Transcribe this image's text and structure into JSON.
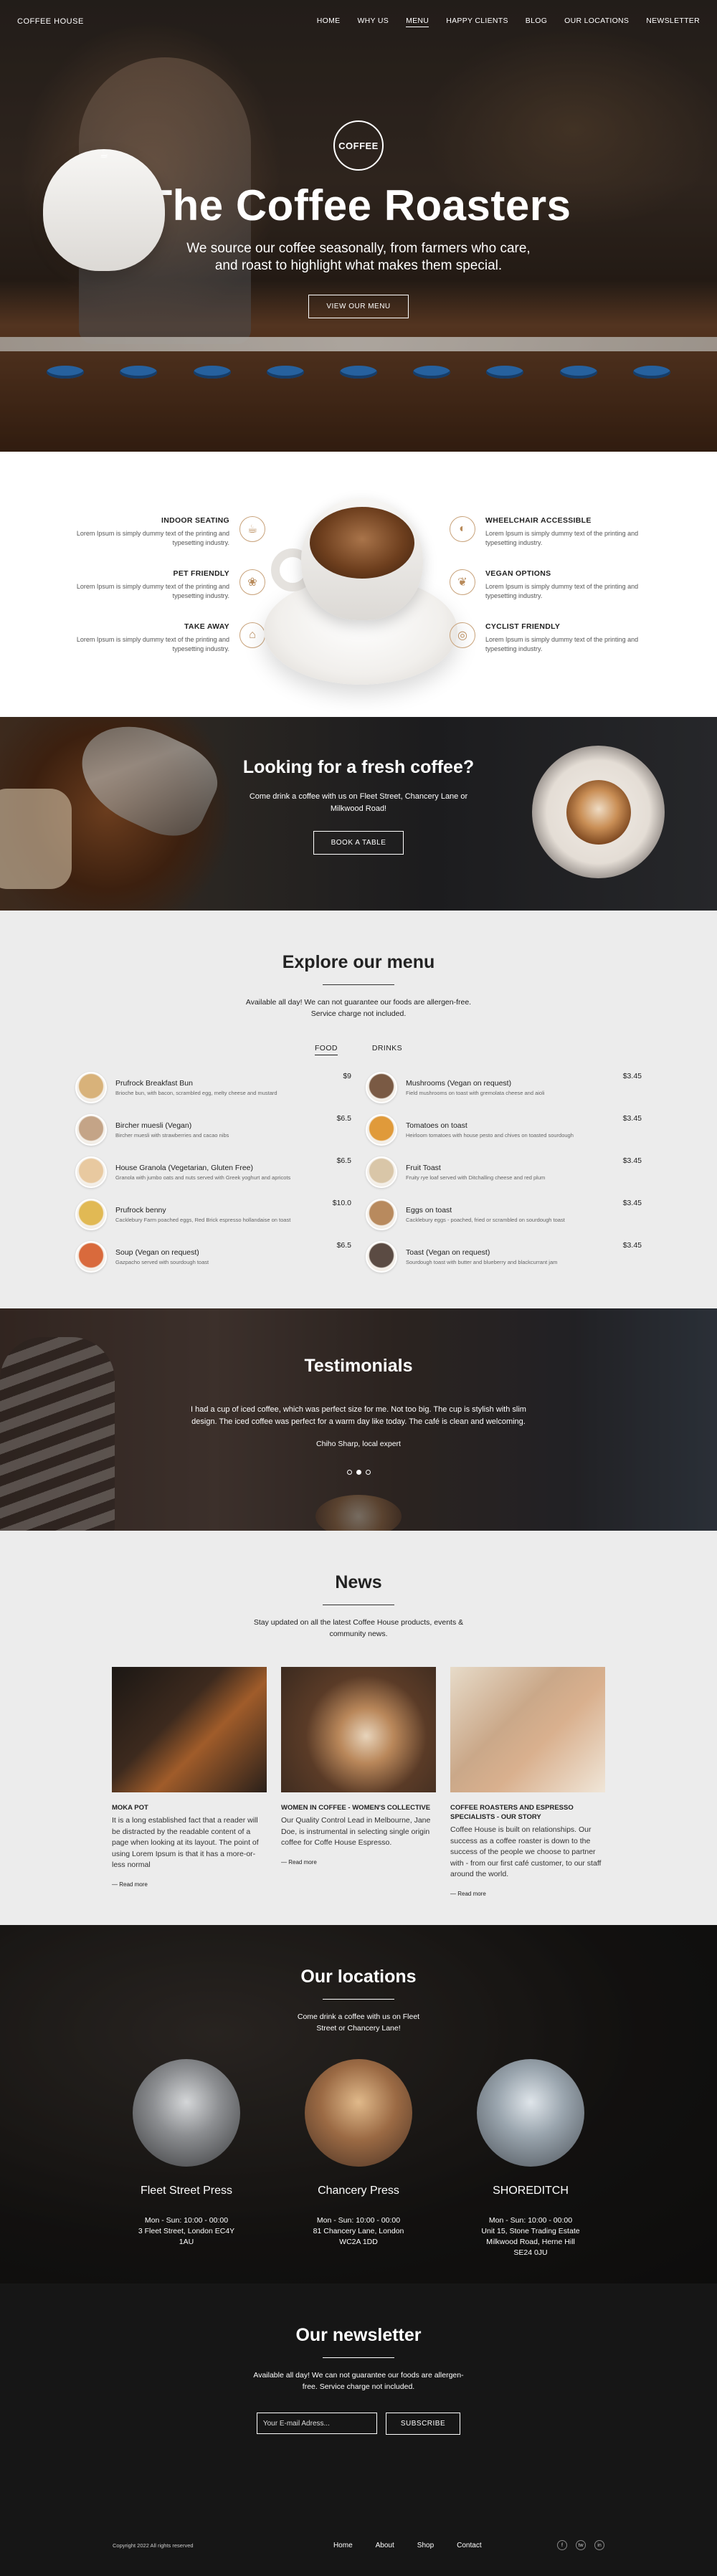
{
  "nav": {
    "brand": "COFFEE HOUSE",
    "items": [
      "HOME",
      "WHY US",
      "MENU",
      "HAPPY CLIENTS",
      "BLOG",
      "OUR LOCATIONS",
      "NEWSLETTER"
    ],
    "active": "MENU"
  },
  "hero": {
    "logo_text": "COFFEE",
    "title": "The Coffee Roasters",
    "subtitle": "We source our coffee seasonally, from farmers who care, and roast to highlight what makes them special.",
    "button": "VIEW OUR MENU"
  },
  "features": {
    "left": [
      {
        "title": "INDOOR SEATING",
        "desc": "Lorem Ipsum is simply dummy text of the printing and typesetting industry.",
        "icon": "coffee-cup-icon"
      },
      {
        "title": "PET FRIENDLY",
        "desc": "Lorem Ipsum is simply dummy text of the printing and typesetting industry.",
        "icon": "paw-icon"
      },
      {
        "title": "TAKE AWAY",
        "desc": "Lorem Ipsum is simply dummy text of the printing and typesetting industry.",
        "icon": "takeaway-cup-icon"
      }
    ],
    "right": [
      {
        "title": "WHEELCHAIR ACCESSIBLE",
        "desc": "Lorem Ipsum is simply dummy text of the printing and typesetting industry.",
        "icon": "coffee-bean-icon"
      },
      {
        "title": "VEGAN OPTIONS",
        "desc": "Lorem Ipsum is simply dummy text of the printing and typesetting industry.",
        "icon": "leaf-icon"
      },
      {
        "title": "CYCLIST FRIENDLY",
        "desc": "Lorem Ipsum is simply dummy text of the printing and typesetting industry.",
        "icon": "cup-saucer-icon"
      }
    ]
  },
  "fresh": {
    "title": "Looking for a fresh coffee?",
    "text": "Come drink a coffee with us on Fleet Street, Chancery Lane or Milkwood Road!",
    "button": "BOOK A TABLE"
  },
  "menu": {
    "title": "Explore our menu",
    "subtitle": "Available all day! We can not guarantee our foods are allergen-free. Service charge not included.",
    "tabs": [
      "FOOD",
      "DRINKS"
    ],
    "active_tab": "FOOD",
    "left": [
      {
        "name": "Prufrock Breakfast Bun",
        "desc": "Brioche bun, with bacon, scrambled egg, melty cheese and mustard",
        "price": "$9",
        "color": "#d8b27a"
      },
      {
        "name": "Bircher muesli (Vegan)",
        "desc": "Bircher muesli with strawberries and cacao nibs",
        "price": "$6.5",
        "color": "#c4a487"
      },
      {
        "name": "House Granola (Vegetarian, Gluten Free)",
        "desc": "Granola with jumbo oats and nuts served with Greek yoghurt and apricots",
        "price": "$6.5",
        "color": "#e8c9a0"
      },
      {
        "name": "Prufrock benny",
        "desc": "Cacklebury Farm poached eggs, Red Brick espresso hollandaise on toast",
        "price": "$10.0",
        "color": "#e1b954"
      },
      {
        "name": "Soup (Vegan on request)",
        "desc": "Gazpacho served with sourdough toast",
        "price": "$6.5",
        "color": "#d96a3c"
      }
    ],
    "right": [
      {
        "name": "Mushrooms (Vegan on request)",
        "desc": "Field mushrooms on toast with gremolata cheese and aioli",
        "price": "$3.45",
        "color": "#7a5a44"
      },
      {
        "name": "Tomatoes on toast",
        "desc": "Heirloom tomatoes with house pesto and chives on toasted sourdough",
        "price": "$3.45",
        "color": "#e09a3a"
      },
      {
        "name": "Fruit Toast",
        "desc": "Fruity rye loaf served with Ditchalling cheese and red plum",
        "price": "$3.45",
        "color": "#d9c6a8"
      },
      {
        "name": "Eggs on toast",
        "desc": "Cacklebury eggs - poached, fried or scrambled on sourdough toast",
        "price": "$3.45",
        "color": "#b88a5e"
      },
      {
        "name": "Toast (Vegan on request)",
        "desc": "Sourdough toast with butter and blueberry and blackcurrant jam",
        "price": "$3.45",
        "color": "#5b4b43"
      }
    ]
  },
  "testimonials": {
    "title": "Testimonials",
    "quote": "I had a cup of iced coffee, which was perfect size for me. Not too big. The cup is stylish with slim design. The iced coffee was perfect for a warm day like today. The café is clean and welcoming.",
    "author": "Chiho Sharp, local expert"
  },
  "news": {
    "title": "News",
    "subtitle": "Stay updated on all the latest Coffee House products, events & community news.",
    "cards": [
      {
        "title": "MOKA POT",
        "desc": "It is a long established fact that a reader will be distracted by the readable content of a page when looking at its layout. The point of using Lorem Ipsum is that it has a more-or-less normal",
        "more": "— Read more"
      },
      {
        "title": "WOMEN IN COFFEE - WOMEN'S COLLECTIVE",
        "desc": "Our Quality Control Lead in Melbourne, Jane Doe, is instrumental in selecting single origin coffee for Coffe House Espresso.",
        "more": "— Read more"
      },
      {
        "title": "COFFEE ROASTERS AND ESPRESSO SPECIALISTS - OUR STORY",
        "desc": "Coffee House is built on relationships. Our success as a coffee roaster is down to the success of the people we choose to partner with - from our first café customer, to our staff around the world.",
        "more": "— Read more"
      }
    ]
  },
  "locations": {
    "title": "Our locations",
    "subtitle": "Come drink a coffee with us on Fleet Street or Chancery Lane!",
    "items": [
      {
        "name": "Fleet Street Press",
        "hours": "Mon - Sun: 10:00 - 00:00",
        "address": "3 Fleet Street, London EC4Y 1AU"
      },
      {
        "name": "Chancery Press",
        "hours": "Mon - Sun: 10:00 - 00:00",
        "address": "81 Chancery Lane, London WC2A 1DD"
      },
      {
        "name": "SHOREDITCH",
        "hours": "Mon - Sun: 10:00 - 00:00",
        "address": "Unit 15, Stone Trading Estate Milkwood Road, Herne Hill SE24 0JU"
      }
    ]
  },
  "newsletter": {
    "title": "Our newsletter",
    "subtitle": "Available all day! We can not guarantee our foods are allergen-free. Service charge not included.",
    "input_placeholder": "Your E-mail Adress...",
    "button": "SUBSCRIBE"
  },
  "footer": {
    "copyright": "Copyright 2022 All rights reserved",
    "links": [
      "Home",
      "About",
      "Shop",
      "Contact"
    ],
    "social": [
      "f",
      "tw",
      "in"
    ]
  }
}
